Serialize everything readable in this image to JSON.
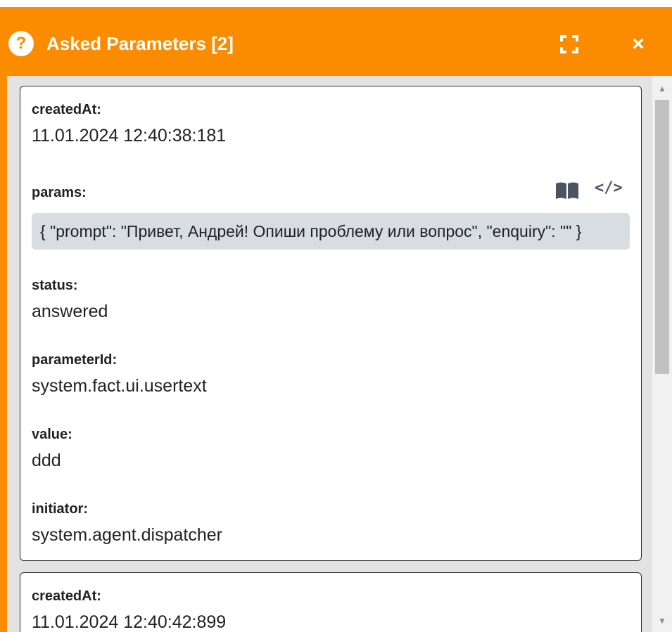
{
  "header": {
    "title": "Asked Parameters [2]",
    "help_icon": "?",
    "close_icon": "×",
    "bg_color": "#fb8c00"
  },
  "scrollbar": {
    "up_arrow": "▲",
    "down_arrow": "▼"
  },
  "cards": [
    {
      "createdAt_label": "createdAt:",
      "createdAt_value": "11.01.2024 12:40:38:181",
      "params_label": "params:",
      "params_value": "{ \"prompt\": \"Привет, Андрей! Опиши проблему или вопрос\", \"enquiry\": \"\" }",
      "code_icon": "</>",
      "status_label": "status:",
      "status_value": "answered",
      "parameterId_label": "parameterId:",
      "parameterId_value": "system.fact.ui.usertext",
      "value_label": "value:",
      "value_value": "ddd",
      "initiator_label": "initiator:",
      "initiator_value": "system.agent.dispatcher"
    },
    {
      "createdAt_label": "createdAt:",
      "createdAt_value": "11.01.2024 12:40:42:899"
    }
  ]
}
